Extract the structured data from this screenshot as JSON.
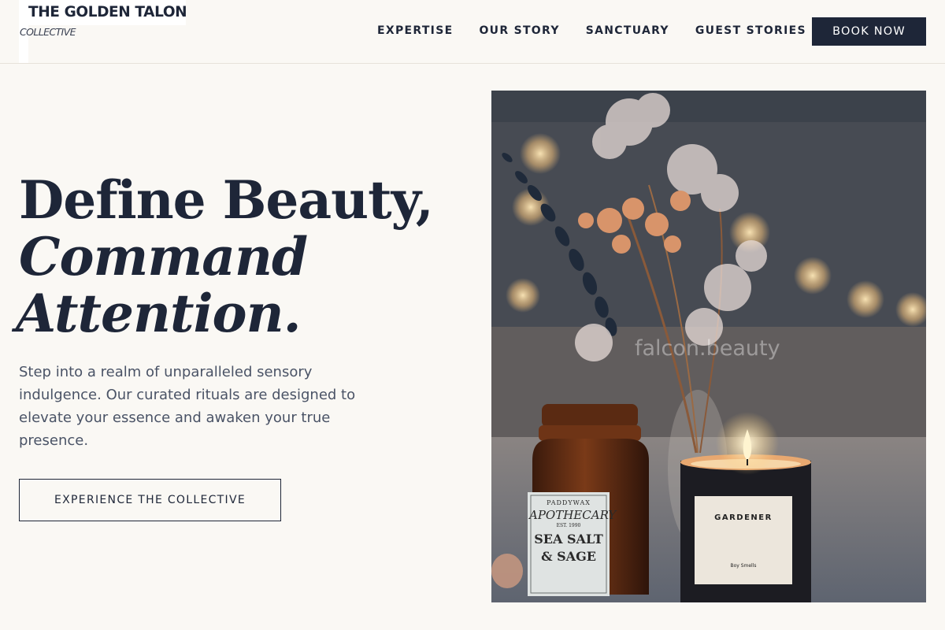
{
  "header": {
    "logo_title": "THE GOLDEN TALON",
    "logo_subtitle": "COLLECTIVE",
    "nav": [
      {
        "label": "EXPERTISE"
      },
      {
        "label": "OUR STORY"
      },
      {
        "label": "SANCTUARY"
      },
      {
        "label": "GUEST STORIES"
      }
    ],
    "book_label": "BOOK NOW"
  },
  "hero": {
    "title_line1": "Define Beauty,",
    "title_line2": "Command",
    "title_line3": "Attention.",
    "description": "Step into a realm of unparalleled sensory indulgence. Our curated rituals are designed to elevate your essence and awaken your true presence.",
    "cta_label": "EXPERIENCE THE COLLECTIVE"
  },
  "image": {
    "watermark": "falcon.beauty",
    "jar_brand": "PADDYWAX",
    "jar_title": "APOTHECARY",
    "jar_est": "EST. 1990",
    "jar_scent_line1": "SEA SALT",
    "jar_scent_line2": "& SAGE",
    "candle_name": "GARDENER",
    "candle_maker": "Boy Smells"
  },
  "colors": {
    "navy": "#1e2638",
    "background": "#faf8f4",
    "text_muted": "#4a5366"
  }
}
